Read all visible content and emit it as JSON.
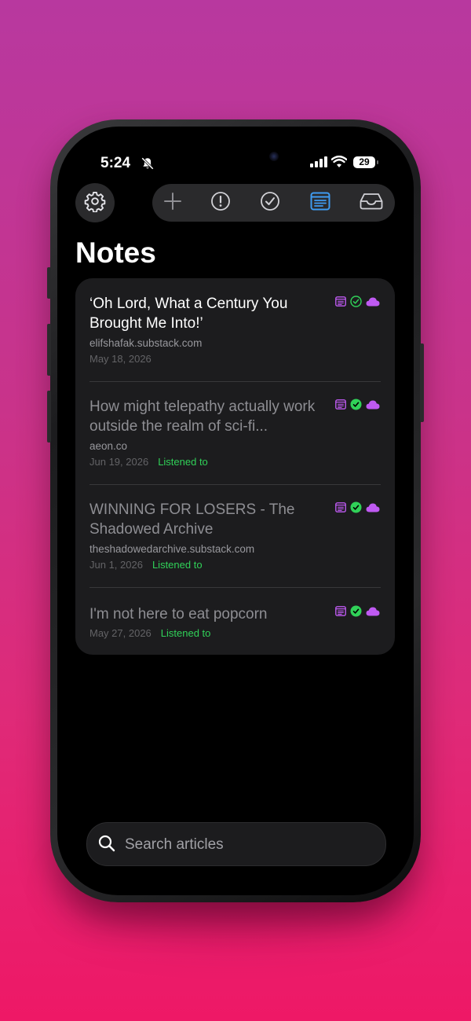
{
  "status_bar": {
    "time": "5:24",
    "battery": "29"
  },
  "toolbar": {
    "items": [
      {
        "icon": "plus-icon",
        "active": false
      },
      {
        "icon": "exclamation-circle-icon",
        "active": false
      },
      {
        "icon": "checkmark-circle-icon",
        "active": false
      },
      {
        "icon": "notes-icon",
        "active": true
      },
      {
        "icon": "inbox-tray-icon",
        "active": false
      }
    ],
    "active_color": "#3f9bf0",
    "inactive_color": "#b0b0b4"
  },
  "page": {
    "title": "Notes"
  },
  "articles": [
    {
      "title": "‘Oh Lord, What a Century You Brought Me Into!’",
      "domain": "elifshafak.substack.com",
      "date": "May 18, 2026",
      "status": ""
    },
    {
      "title": "How might telepathy actually work outside the realm of sci-fi...",
      "domain": "aeon.co",
      "date": "Jun 19, 2026",
      "status": "Listened to"
    },
    {
      "title": "WINNING FOR LOSERS - The Shadowed Archive",
      "domain": "theshadowedarchive.substack.com",
      "date": "Jun 1, 2026",
      "status": "Listened to"
    },
    {
      "title": "I'm not here to eat popcorn",
      "domain": "",
      "date": "May 27, 2026",
      "status": "Listened to"
    }
  ],
  "colors": {
    "note_icon": "#bf5af2",
    "check_icon": "#30d158",
    "cloud_icon": "#bf5af2"
  },
  "search": {
    "placeholder": "Search articles"
  }
}
